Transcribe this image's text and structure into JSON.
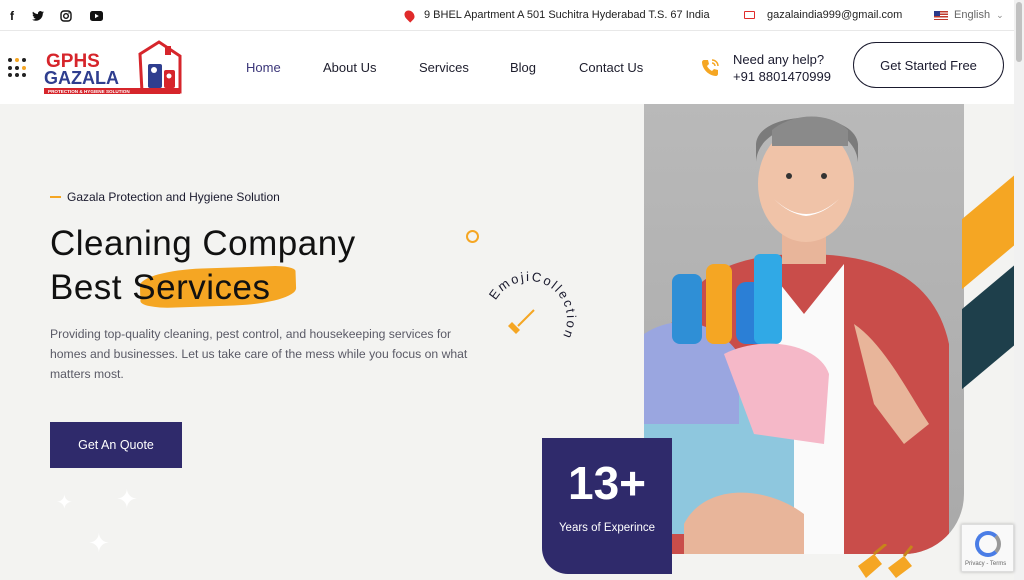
{
  "topbar": {
    "address": "9 BHEL Apartment A 501 Suchitra Hyderabad T.S. 67 India",
    "email": "gazalaindia999@gmail.com",
    "language": "English",
    "social": [
      "f",
      "t",
      "o",
      "▶"
    ]
  },
  "brand": {
    "logo_line1": "GPHS",
    "logo_line2": "GAZALA",
    "logo_tagline": "PROTECTION & HYGIENE SOLUTION"
  },
  "nav": {
    "items": [
      "Home",
      "About Us",
      "Services",
      "Blog",
      "Contact Us"
    ],
    "help_label": "Need any help?",
    "help_phone": "+91 8801470999",
    "cta_label": "Get Started Free"
  },
  "hero": {
    "eyebrow": "Gazala Protection and Hygiene Solution",
    "title_line1": "Cleaning Company",
    "title_line2_prefix": "Best ",
    "title_line2_highlight": "Services",
    "description": "Providing top-quality cleaning, pest control, and housekeeping services for homes and businesses. Let us take care of the mess while you focus on what matters most.",
    "quote_button": "Get An Quote",
    "circle_text": "EmojiCollection",
    "experience_number": "13+",
    "experience_label": "Years of Experince"
  },
  "recaptcha": {
    "text": "Privacy - Terms"
  },
  "colors": {
    "accent": "#f5a623",
    "primary": "#2f2a6b",
    "teal": "#1e3f4b",
    "red": "#e02b2b"
  }
}
